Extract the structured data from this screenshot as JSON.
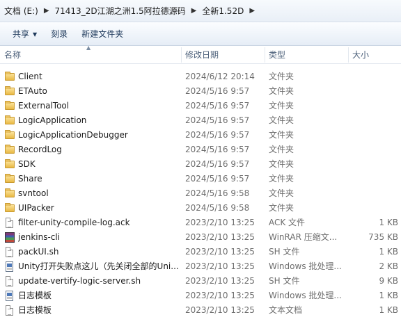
{
  "address_bar": {
    "crumbs": [
      "文档 (E:)",
      "71413_2D江湖之洲1.5阿拉德源码",
      "全新1.52D"
    ]
  },
  "toolbar": {
    "share_label": "共享",
    "burn_label": "刻录",
    "new_folder_label": "新建文件夹"
  },
  "columns": {
    "name": "名称",
    "date": "修改日期",
    "type": "类型",
    "size": "大小"
  },
  "files": [
    {
      "icon": "folder-icon",
      "name": "Client",
      "date": "2024/6/12 20:14",
      "type": "文件夹",
      "size": ""
    },
    {
      "icon": "folder-icon",
      "name": "ETAuto",
      "date": "2024/5/16 9:57",
      "type": "文件夹",
      "size": ""
    },
    {
      "icon": "folder-icon",
      "name": "ExternalTool",
      "date": "2024/5/16 9:57",
      "type": "文件夹",
      "size": ""
    },
    {
      "icon": "folder-icon",
      "name": "LogicApplication",
      "date": "2024/5/16 9:57",
      "type": "文件夹",
      "size": ""
    },
    {
      "icon": "folder-icon",
      "name": "LogicApplicationDebugger",
      "date": "2024/5/16 9:57",
      "type": "文件夹",
      "size": ""
    },
    {
      "icon": "folder-icon",
      "name": "RecordLog",
      "date": "2024/5/16 9:57",
      "type": "文件夹",
      "size": ""
    },
    {
      "icon": "folder-icon",
      "name": "SDK",
      "date": "2024/5/16 9:57",
      "type": "文件夹",
      "size": ""
    },
    {
      "icon": "folder-icon",
      "name": "Share",
      "date": "2024/5/16 9:57",
      "type": "文件夹",
      "size": ""
    },
    {
      "icon": "folder-icon",
      "name": "svntool",
      "date": "2024/5/16 9:58",
      "type": "文件夹",
      "size": ""
    },
    {
      "icon": "folder-icon",
      "name": "UIPacker",
      "date": "2024/5/16 9:58",
      "type": "文件夹",
      "size": ""
    },
    {
      "icon": "document-icon",
      "name": "filter-unity-compile-log.ack",
      "date": "2023/2/10 13:25",
      "type": "ACK 文件",
      "size": "1 KB"
    },
    {
      "icon": "winrar-archive-icon",
      "name": "jenkins-cli",
      "date": "2023/2/10 13:25",
      "type": "WinRAR 压缩文...",
      "size": "735 KB"
    },
    {
      "icon": "document-icon",
      "name": "packUI.sh",
      "date": "2023/2/10 13:25",
      "type": "SH 文件",
      "size": "1 KB"
    },
    {
      "icon": "batch-file-icon",
      "name": "Unity打开失败点这儿（先关闭全部的Uni...",
      "date": "2023/2/10 13:25",
      "type": "Windows 批处理...",
      "size": "2 KB"
    },
    {
      "icon": "document-icon",
      "name": "update-vertify-logic-server.sh",
      "date": "2023/2/10 13:25",
      "type": "SH 文件",
      "size": "9 KB"
    },
    {
      "icon": "batch-file-icon",
      "name": "日志模板",
      "date": "2023/2/10 13:25",
      "type": "Windows 批处理...",
      "size": "1 KB"
    },
    {
      "icon": "text-document-icon",
      "name": "日志模板",
      "date": "2023/2/10 13:25",
      "type": "文本文档",
      "size": "1 KB"
    }
  ]
}
